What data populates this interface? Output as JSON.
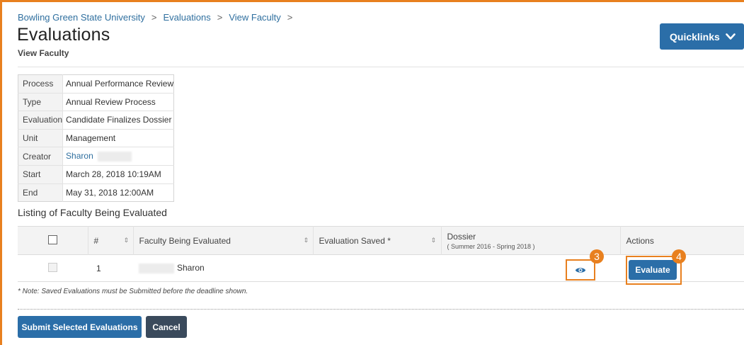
{
  "breadcrumb": {
    "items": [
      "Bowling Green State University",
      "Evaluations",
      "View Faculty"
    ],
    "separator": ">"
  },
  "page": {
    "title": "Evaluations",
    "subtitle": "View Faculty"
  },
  "quicklinks": {
    "label": "Quicklinks",
    "icon": "chevron-down-icon"
  },
  "info": [
    {
      "key": "Process",
      "value": "Annual Performance Review"
    },
    {
      "key": "Type",
      "value": "Annual Review Process"
    },
    {
      "key": "Evaluation",
      "value": "Candidate Finalizes Dossier"
    },
    {
      "key": "Unit",
      "value": "Management"
    },
    {
      "key": "Creator",
      "value": "Sharon"
    },
    {
      "key": "Start",
      "value": "March 28, 2018 10:19AM"
    },
    {
      "key": "End",
      "value": "May 31, 2018 12:00AM"
    }
  ],
  "listing": {
    "heading": "Listing of Faculty Being Evaluated",
    "columns": {
      "number": "#",
      "faculty": "Faculty Being Evaluated",
      "saved": "Evaluation Saved *",
      "dossier": "Dossier",
      "dossier_range": "( Summer 2016 - Spring 2018 )",
      "actions": "Actions"
    },
    "sort_glyph": "⇕",
    "rows": [
      {
        "number": "1",
        "faculty": "Sharon",
        "saved": "",
        "action": "Evaluate"
      }
    ]
  },
  "badges": {
    "eye": "3",
    "evaluate": "4"
  },
  "note": "* Note: Saved Evaluations must be Submitted before the deadline shown.",
  "buttons": {
    "submit": "Submit Selected Evaluations",
    "cancel": "Cancel"
  },
  "colors": {
    "accent": "#2b6ea8",
    "highlight": "#e8801f",
    "link": "#2f6f9f"
  }
}
